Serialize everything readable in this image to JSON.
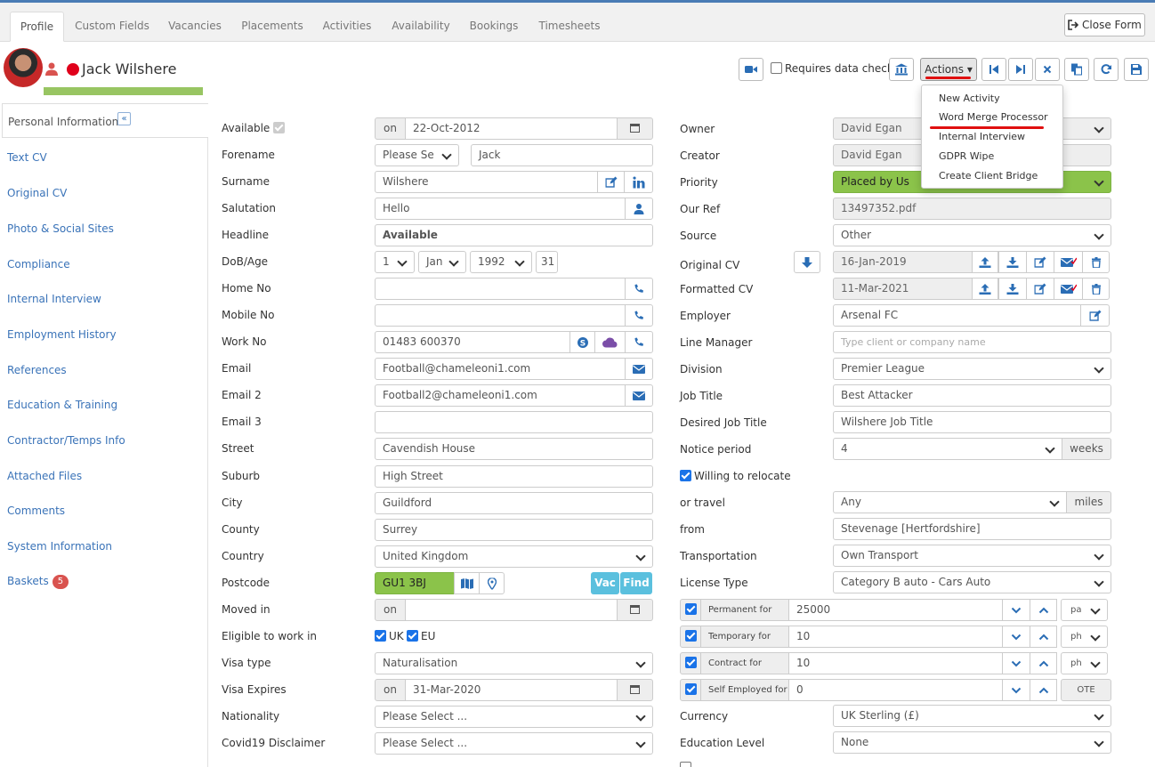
{
  "tabs": [
    "Profile",
    "Custom Fields",
    "Vacancies",
    "Placements",
    "Activities",
    "Availability",
    "Bookings",
    "Timesheets"
  ],
  "close_form": "Close Form",
  "candidate": {
    "name": "Jack Wilshere"
  },
  "toolbar": {
    "requires_data_check": "Requires data check",
    "actions": "Actions"
  },
  "actions_menu": [
    "New Activity",
    "Word Merge Processor",
    "Internal Interview",
    "GDPR Wipe",
    "Create Client Bridge"
  ],
  "sidebar": {
    "header": "Personal Information",
    "items": [
      "Text CV",
      "Original CV",
      "Photo & Social Sites",
      "Compliance",
      "Internal Interview",
      "Employment History",
      "References",
      "Education & Training",
      "Contractor/Temps Info",
      "Attached Files",
      "Comments",
      "System Information",
      "Baskets"
    ],
    "baskets_count": "5"
  },
  "left": {
    "available": {
      "label": "Available",
      "on": "on",
      "date": "22-Oct-2012"
    },
    "forename": {
      "label": "Forename",
      "title": "Please Se",
      "value": "Jack"
    },
    "surname": {
      "label": "Surname",
      "value": "Wilshere"
    },
    "salutation": {
      "label": "Salutation",
      "value": "Hello"
    },
    "headline": {
      "label": "Headline",
      "value": "Available"
    },
    "dob": {
      "label": "DoB/Age",
      "day": "1",
      "month": "Jan",
      "year": "1992",
      "age": "31"
    },
    "home_no": {
      "label": "Home No",
      "value": ""
    },
    "mobile_no": {
      "label": "Mobile No",
      "value": ""
    },
    "work_no": {
      "label": "Work No",
      "value": "01483 600370"
    },
    "email": {
      "label": "Email",
      "value": "Football@chameleoni1.com"
    },
    "email2": {
      "label": "Email 2",
      "value": "Football2@chameleoni1.com"
    },
    "email3": {
      "label": "Email 3",
      "value": ""
    },
    "street": {
      "label": "Street",
      "value": "Cavendish House"
    },
    "suburb": {
      "label": "Suburb",
      "value": "High Street"
    },
    "city": {
      "label": "City",
      "value": "Guildford"
    },
    "county": {
      "label": "County",
      "value": "Surrey"
    },
    "country": {
      "label": "Country",
      "value": "United Kingdom"
    },
    "postcode": {
      "label": "Postcode",
      "value": "GU1 3BJ",
      "vac": "Vac",
      "find": "Find"
    },
    "moved_in": {
      "label": "Moved in",
      "on": "on",
      "value": ""
    },
    "eligible": {
      "label": "Eligible to work in",
      "uk": "UK",
      "eu": "EU"
    },
    "visa_type": {
      "label": "Visa type",
      "value": "Naturalisation"
    },
    "visa_expires": {
      "label": "Visa Expires",
      "on": "on",
      "value": "31-Mar-2020"
    },
    "nationality": {
      "label": "Nationality",
      "value": "Please Select ..."
    },
    "covid": {
      "label": "Covid19 Disclaimer",
      "value": "Please Select ..."
    }
  },
  "right": {
    "owner": {
      "label": "Owner",
      "value": "David Egan"
    },
    "creator": {
      "label": "Creator",
      "value": "David Egan"
    },
    "priority": {
      "label": "Priority",
      "value": "Placed by Us"
    },
    "our_ref": {
      "label": "Our Ref",
      "value": "13497352.pdf"
    },
    "source": {
      "label": "Source",
      "value": "Other"
    },
    "original_cv": {
      "label": "Original CV",
      "value": "16-Jan-2019"
    },
    "formatted_cv": {
      "label": "Formatted CV",
      "value": "11-Mar-2021"
    },
    "employer": {
      "label": "Employer",
      "value": "Arsenal FC"
    },
    "line_manager": {
      "label": "Line Manager",
      "placeholder": "Type client or company name"
    },
    "division": {
      "label": "Division",
      "value": "Premier League"
    },
    "job_title": {
      "label": "Job Title",
      "value": "Best Attacker"
    },
    "desired_job_title": {
      "label": "Desired Job Title",
      "value": "Wilshere Job Title"
    },
    "notice": {
      "label": "Notice period",
      "value": "4",
      "unit": "weeks"
    },
    "relocate": {
      "label": "Willing to relocate"
    },
    "travel": {
      "label": "or travel",
      "value": "Any",
      "unit": "miles"
    },
    "from": {
      "label": "from",
      "value": "Stevenage [Hertfordshire]"
    },
    "transportation": {
      "label": "Transportation",
      "value": "Own Transport"
    },
    "license": {
      "label": "License Type",
      "value": "Category B auto - Cars Auto"
    },
    "permanent": {
      "label": "Permanent for",
      "value": "25000",
      "unit": "pa"
    },
    "temporary": {
      "label": "Temporary for",
      "value": "10",
      "unit": "ph"
    },
    "contract": {
      "label": "Contract for",
      "value": "10",
      "unit": "ph"
    },
    "self_employed": {
      "label": "Self Employed for",
      "value": "0",
      "unit": "OTE"
    },
    "currency": {
      "label": "Currency",
      "value": "UK Sterling (£)"
    },
    "education": {
      "label": "Education Level",
      "value": "None"
    }
  },
  "colors": {
    "accent": "#2a6db5",
    "status": "#e0001b",
    "green": "#8bc34a",
    "teal": "#5bc0de",
    "badge": "#d9534f"
  }
}
